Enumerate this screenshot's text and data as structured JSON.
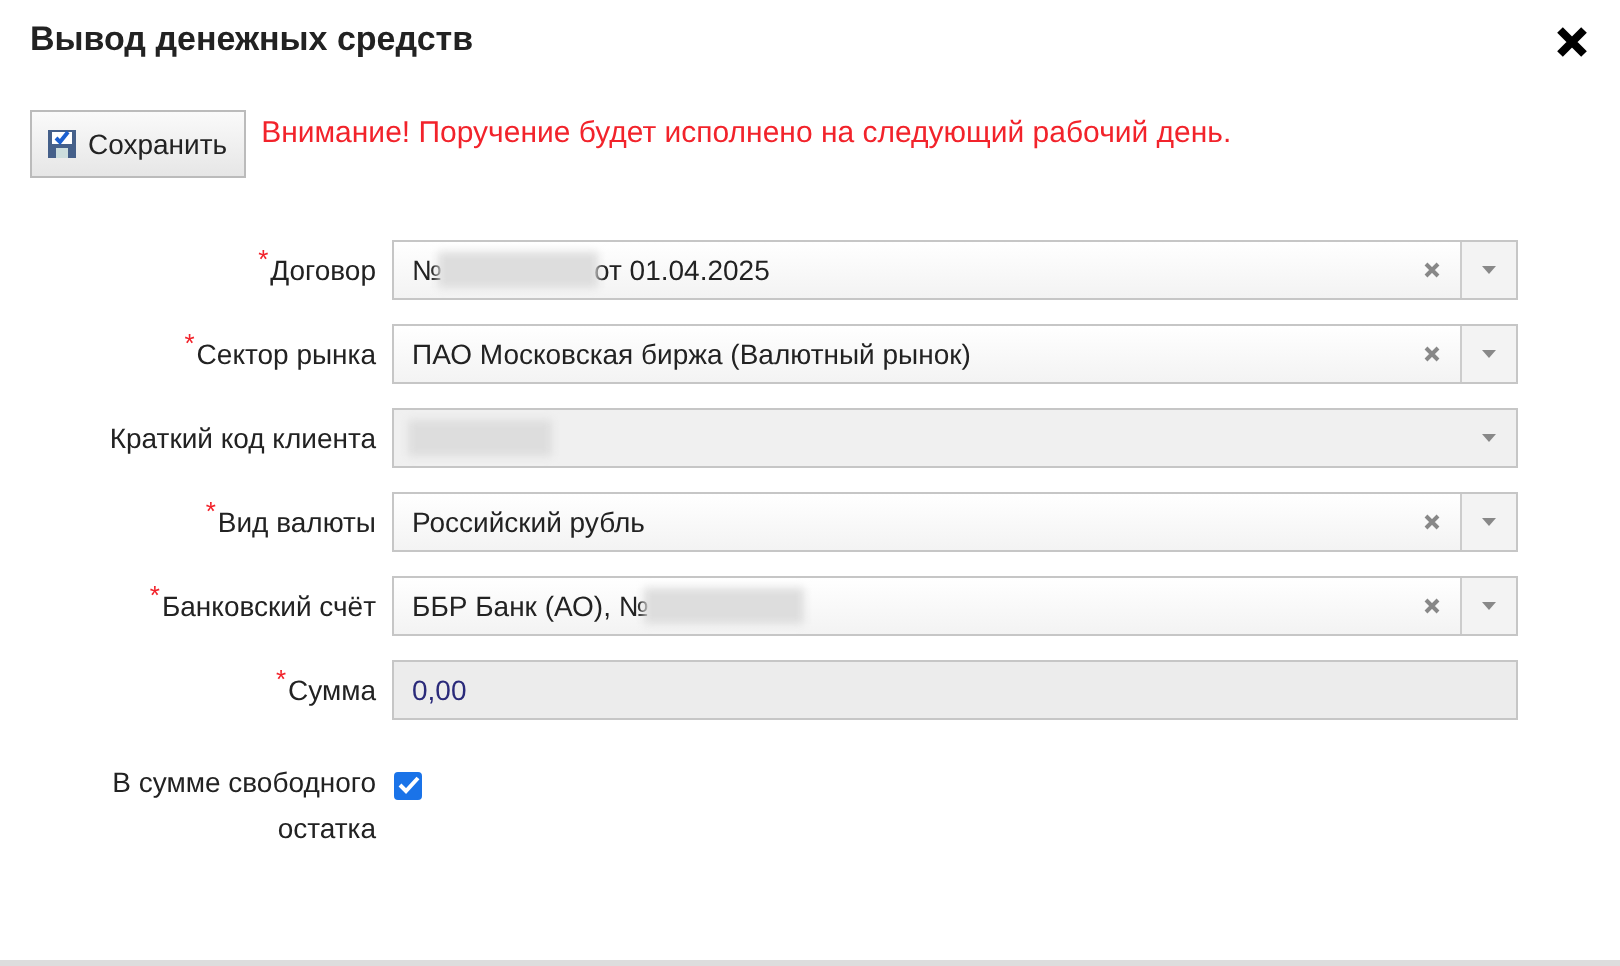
{
  "window": {
    "title": "Вывод денежных средств"
  },
  "toolbar": {
    "save_button": "Сохранить",
    "warning": "Внимание! Поручение будет исполнено на следующий рабочий день."
  },
  "fields": [
    {
      "kind": "select",
      "label": "Договор",
      "required": true,
      "value": "№",
      "redacted": true,
      "value_after": "от 01.04.2025",
      "disabled": false,
      "clearable": true
    },
    {
      "kind": "select",
      "label": "Сектор рынка",
      "required": true,
      "value": "ПАО Московская биржа (Валютный рынок)",
      "redacted": false,
      "disabled": false,
      "clearable": true
    },
    {
      "kind": "select",
      "label": "Краткий код клиента",
      "required": false,
      "redacted": true,
      "disabled": true,
      "clearable": false
    },
    {
      "kind": "select",
      "label": "Вид валюты",
      "required": true,
      "value": "Российский рубль",
      "redacted": false,
      "disabled": false,
      "clearable": true
    },
    {
      "kind": "select",
      "label": "Банковский счёт",
      "required": true,
      "value": "ББР Банк (АО), №",
      "redacted": true,
      "disabled": false,
      "clearable": true
    },
    {
      "kind": "text",
      "label": "Сумма",
      "required": true,
      "value": "0,00",
      "disabled": true
    },
    {
      "kind": "checkbox",
      "label": "В сумме свободного остатка",
      "required": false,
      "checked": true
    }
  ],
  "required_mark": "*"
}
